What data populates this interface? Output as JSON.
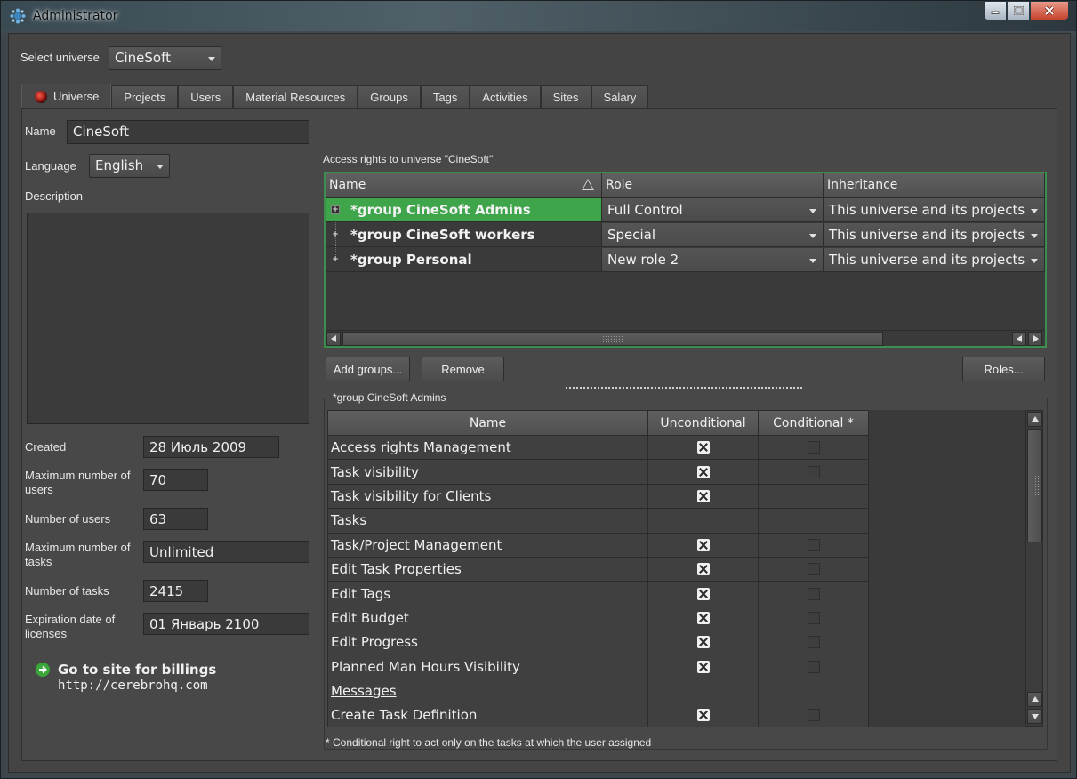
{
  "window": {
    "title": "Administrator"
  },
  "universe_select": {
    "label": "Select universe",
    "value": "CineSoft"
  },
  "tabs": [
    {
      "label": "Universe",
      "active": true
    },
    {
      "label": "Projects"
    },
    {
      "label": "Users"
    },
    {
      "label": "Material Resources"
    },
    {
      "label": "Groups"
    },
    {
      "label": "Tags"
    },
    {
      "label": "Activities"
    },
    {
      "label": "Sites"
    },
    {
      "label": "Salary"
    }
  ],
  "universe": {
    "name_label": "Name",
    "name_value": "CineSoft",
    "language_label": "Language",
    "language_value": "English",
    "description_label": "Description",
    "created_label": "Created",
    "created_value": "28 Июль 2009",
    "max_users_label": "Maximum number of users",
    "max_users_value": "70",
    "num_users_label": "Number of users",
    "num_users_value": "63",
    "max_tasks_label": "Maximum number of tasks",
    "max_tasks_value": "Unlimited",
    "num_tasks_label": "Number of tasks",
    "num_tasks_value": "2415",
    "expiration_label": "Expiration date of licenses",
    "expiration_value": "01 Январь 2100",
    "billing_title": "Go to site for billings",
    "billing_url": "http://cerebrohq.com"
  },
  "access": {
    "caption": "Access rights to universe \"CineSoft\"",
    "columns": {
      "name": "Name",
      "role": "Role",
      "inheritance": "Inheritance"
    },
    "rows": [
      {
        "name": "*group CineSoft Admins",
        "role": "Full Control",
        "inheritance": "This universe and its projects"
      },
      {
        "name": "*group CineSoft workers",
        "role": "Special",
        "inheritance": "This universe and its projects"
      },
      {
        "name": "*group Personal",
        "role": "New role 2",
        "inheritance": "This universe and its projects"
      }
    ],
    "add_button": "Add groups...",
    "remove_button": "Remove",
    "roles_button": "Roles..."
  },
  "rights": {
    "group_caption": "*group CineSoft Admins",
    "columns": {
      "name": "Name",
      "unconditional": "Unconditional",
      "conditional": "Conditional *"
    },
    "rows": [
      {
        "name": "Access rights Management",
        "unconditional": true,
        "conditional": false
      },
      {
        "name": "Task visibility",
        "unconditional": true,
        "conditional": false
      },
      {
        "name": "Task visibility for Clients",
        "unconditional": true,
        "conditional": null
      },
      {
        "name": "Tasks",
        "section": true
      },
      {
        "name": "Task/Project Management",
        "unconditional": true,
        "conditional": false
      },
      {
        "name": "Edit Task Properties",
        "unconditional": true,
        "conditional": false
      },
      {
        "name": "Edit Tags",
        "unconditional": true,
        "conditional": false
      },
      {
        "name": "Edit Budget",
        "unconditional": true,
        "conditional": false
      },
      {
        "name": "Edit Progress",
        "unconditional": true,
        "conditional": false
      },
      {
        "name": "Planned Man Hours Visibility",
        "unconditional": true,
        "conditional": false
      },
      {
        "name": "Messages",
        "section": true
      },
      {
        "name": "Create Task Definition",
        "unconditional": true,
        "conditional": false
      }
    ],
    "footnote": "* Conditional right to act only on the tasks at which the user assigned"
  },
  "colors": {
    "selected_row": "#3ea54a",
    "grid_border": "#3b8e4c",
    "background": "#444444"
  },
  "icons": [
    "app-icon",
    "minimize-icon",
    "maximize-icon",
    "close-icon",
    "universe-tab-icon",
    "sort-up-icon",
    "expand-icon",
    "arrow-right-icon",
    "dropdown-icon",
    "checkmark-icon"
  ]
}
